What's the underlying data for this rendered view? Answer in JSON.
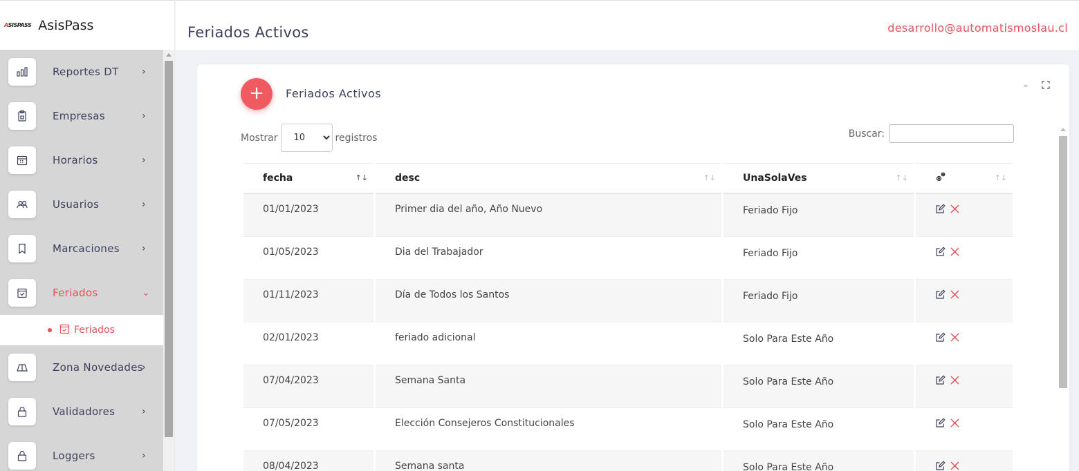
{
  "brand": {
    "logo_text": "ASISPASS",
    "name": "AsisPass"
  },
  "header": {
    "title": "Feriados Activos",
    "user_email": "desarrollo@automatismoslau.cl"
  },
  "sidebar": {
    "items": [
      {
        "label": "Reportes DT",
        "icon": "bar-chart-icon"
      },
      {
        "label": "Empresas",
        "icon": "clipboard-icon"
      },
      {
        "label": "Horarios",
        "icon": "calendar-grid-icon"
      },
      {
        "label": "Usuarios",
        "icon": "users-icon"
      },
      {
        "label": "Marcaciones",
        "icon": "bookmark-icon"
      },
      {
        "label": "Feriados",
        "icon": "calendar-check-icon",
        "active": true
      },
      {
        "label": "Zona Novedades",
        "icon": "map-icon"
      },
      {
        "label": "Validadores",
        "icon": "lock-icon"
      },
      {
        "label": "Loggers",
        "icon": "lock-icon"
      }
    ],
    "submenu": {
      "label": "Feriados"
    }
  },
  "card": {
    "title": "Feriados Activos",
    "length": {
      "prefix": "Mostrar",
      "value": "10",
      "suffix": "registros"
    },
    "search": {
      "label": "Buscar:",
      "value": ""
    },
    "columns": [
      "fecha",
      "desc",
      "UnaSolaVes",
      ""
    ],
    "rows": [
      {
        "fecha": "01/01/2023",
        "desc": "Primer dia del año, Año Nuevo",
        "tipo": "Feriado Fijo"
      },
      {
        "fecha": "01/05/2023",
        "desc": "Dia del Trabajador",
        "tipo": "Feriado Fijo"
      },
      {
        "fecha": "01/11/2023",
        "desc": "Día de Todos los Santos",
        "tipo": "Feriado Fijo"
      },
      {
        "fecha": "02/01/2023",
        "desc": "feriado adicional",
        "tipo": "Solo Para Este Año"
      },
      {
        "fecha": "07/04/2023",
        "desc": "Semana Santa",
        "tipo": "Solo Para Este Año"
      },
      {
        "fecha": "07/05/2023",
        "desc": "Elección Consejeros Constitucionales",
        "tipo": "Solo Para Este Año"
      },
      {
        "fecha": "08/04/2023",
        "desc": "Semana santa",
        "tipo": "Solo Para Este Año"
      }
    ]
  },
  "colors": {
    "accent": "#e7515a",
    "text": "#3b3f5c",
    "sidebar_bg": "#d6d6d6"
  }
}
